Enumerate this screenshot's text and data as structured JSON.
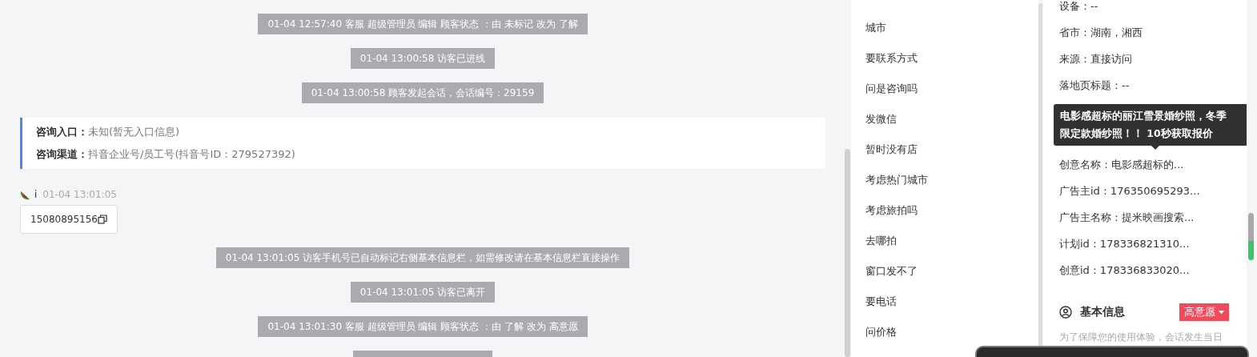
{
  "chat": {
    "events": [
      {
        "kind": "partial"
      },
      {
        "kind": "system",
        "text": "01-04 12:57:40 客服 超级管理员 编辑 顾客状态 ：由 未标记 改为 了解"
      },
      {
        "kind": "system",
        "text": "01-04 13:00:58 访客已进线"
      },
      {
        "kind": "system",
        "text": "01-04 13:00:58 顾客发起会话，会话编号：29159"
      },
      {
        "kind": "entry",
        "rows": [
          {
            "label": "咨询入口：",
            "value": "未知(暂无入口信息)"
          },
          {
            "label": "咨询渠道：",
            "value": "抖音企业号/员工号(抖音号ID：279527392)"
          }
        ]
      },
      {
        "kind": "message",
        "sender": "i",
        "time": "01-04 13:01:05",
        "text": "15080895156"
      },
      {
        "kind": "system",
        "text": "01-04 13:01:05 访客手机号已自动标记右侧基本信息栏，如需修改请在基本信息栏直接操作"
      },
      {
        "kind": "system",
        "text": "01-04 13:01:05 访客已离开"
      },
      {
        "kind": "system",
        "text": "01-04 13:01:30 客服 超级管理员 编辑 顾客状态 ：由 了解 改为 高意愿"
      },
      {
        "kind": "partial"
      }
    ]
  },
  "quick_replies": [
    "城市",
    "要联系方式",
    "问是咨询吗",
    "发微信",
    "暂时没有店",
    "考虑热门城市",
    "考虑旅拍吗",
    "去哪拍",
    "窗口发不了",
    "要电话",
    "问价格"
  ],
  "visitor_info": {
    "fields": [
      {
        "kind": "field",
        "text": "设备：--"
      },
      {
        "kind": "field",
        "text": "省市：湖南，湘西"
      },
      {
        "kind": "field",
        "text": "来源：直接访问"
      },
      {
        "kind": "field",
        "text": "落地页标题：--"
      },
      {
        "kind": "hidden"
      },
      {
        "kind": "hidden"
      },
      {
        "kind": "field",
        "text": "创意名称：电影感超标的..."
      },
      {
        "kind": "field",
        "text": "广告主id：176350695293..."
      },
      {
        "kind": "field",
        "text": "广告主名称：提米映画搜索..."
      },
      {
        "kind": "field",
        "text": "计划id：178336821310..."
      },
      {
        "kind": "field",
        "text": "创意id：178336833020..."
      }
    ],
    "tooltip": "电影感超标的丽江雪景婚纱照，冬季限定款婚纱照！！ 10秒获取报价"
  },
  "basic_info": {
    "title": "基本信息",
    "status_tag": "高意愿",
    "note": "为了保障您的使用体验，会话发生当日"
  }
}
